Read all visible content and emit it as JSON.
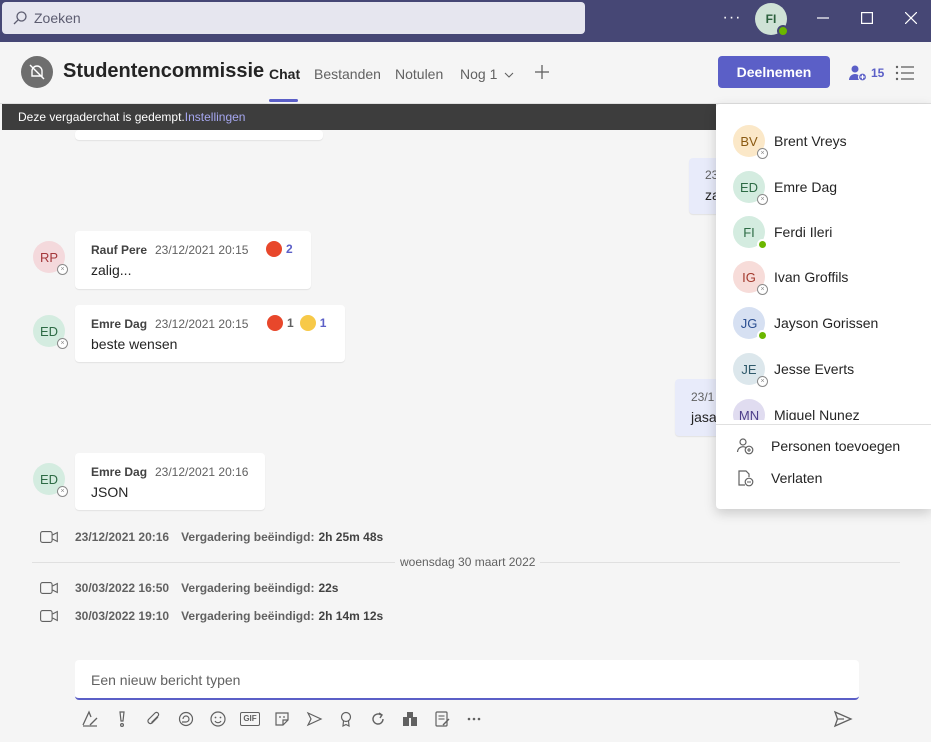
{
  "titlebar": {
    "search_placeholder": "Zoeken",
    "more": "···",
    "user_initials": "FI"
  },
  "header": {
    "chat_title": "Studentencommissie",
    "tabs": [
      {
        "label": "Chat"
      },
      {
        "label": "Bestanden"
      },
      {
        "label": "Notulen"
      },
      {
        "label": "Nog 1"
      }
    ],
    "join_label": "Deelnemen",
    "participant_count": "15"
  },
  "banner": {
    "text": "Deze vergaderchat is gedempt.",
    "link": "Instellingen"
  },
  "messages": [
    {
      "initials": "RP",
      "sender": "Rauf Pere",
      "time": "23/12/2021 20:15",
      "text": "zalig...",
      "reactions": [
        {
          "emoji": "angry",
          "count": "2"
        }
      ]
    },
    {
      "initials": "ED",
      "sender": "Emre Dag",
      "time": "23/12/2021 20:15",
      "text": "beste wensen",
      "reactions": [
        {
          "emoji": "angry",
          "count": "1"
        },
        {
          "emoji": "sad",
          "count": "1"
        }
      ]
    },
    {
      "initials": "ED",
      "sender": "Emre Dag",
      "time": "23/12/2021 20:16",
      "text": "JSON"
    }
  ],
  "own_messages": [
    {
      "time": "23",
      "text": "za"
    },
    {
      "time": "23/1",
      "text": "jasa"
    }
  ],
  "events": [
    {
      "time": "23/12/2021 20:16",
      "label": "Vergadering beëindigd:",
      "duration": "2h 25m 48s"
    },
    {
      "time": "30/03/2022 16:50",
      "label": "Vergadering beëindigd:",
      "duration": "22s"
    },
    {
      "time": "30/03/2022 19:10",
      "label": "Vergadering beëindigd:",
      "duration": "2h 14m 12s"
    }
  ],
  "date_divider": "woensdag 30 maart 2022",
  "compose": {
    "placeholder": "Een nieuw bericht typen"
  },
  "toolbar_icons": [
    "format-icon",
    "important-icon",
    "attach-icon",
    "loop-icon",
    "emoji-icon",
    "gif-icon",
    "sticker-icon",
    "schedule-meeting-icon",
    "praise-icon",
    "loop-component-icon",
    "apps-icon",
    "approvals-icon",
    "more-icon"
  ],
  "gif_label": "GIF",
  "participants": [
    {
      "initials": "BV",
      "name": "Brent Vreys",
      "status": "away",
      "bg": "#fbe8c8",
      "fg": "#8a5a12"
    },
    {
      "initials": "ED",
      "name": "Emre Dag",
      "status": "away",
      "bg": "#d4ece0",
      "fg": "#2d6b45"
    },
    {
      "initials": "FI",
      "name": "Ferdi Ileri",
      "status": "online",
      "bg": "#d4ece0",
      "fg": "#2d6b45"
    },
    {
      "initials": "IG",
      "name": "Ivan Groffils",
      "status": "away",
      "bg": "#f7dcd9",
      "fg": "#a33a2e"
    },
    {
      "initials": "JG",
      "name": "Jayson Gorissen",
      "status": "online",
      "bg": "#d6e0f2",
      "fg": "#2b4f91"
    },
    {
      "initials": "JE",
      "name": "Jesse Everts",
      "status": "away",
      "bg": "#dce7ec",
      "fg": "#2f5a6b"
    },
    {
      "initials": "MN",
      "name": "Miguel Nunez",
      "status": "away",
      "bg": "#e0dcf0",
      "fg": "#4e3f8a"
    }
  ],
  "panel_actions": [
    {
      "label": "Personen toevoegen",
      "icon": "add-people-icon"
    },
    {
      "label": "Verlaten",
      "icon": "leave-icon"
    }
  ],
  "colors": {
    "titlebar": "#464775",
    "accent": "#5b5fc7",
    "online": "#6bb700"
  }
}
